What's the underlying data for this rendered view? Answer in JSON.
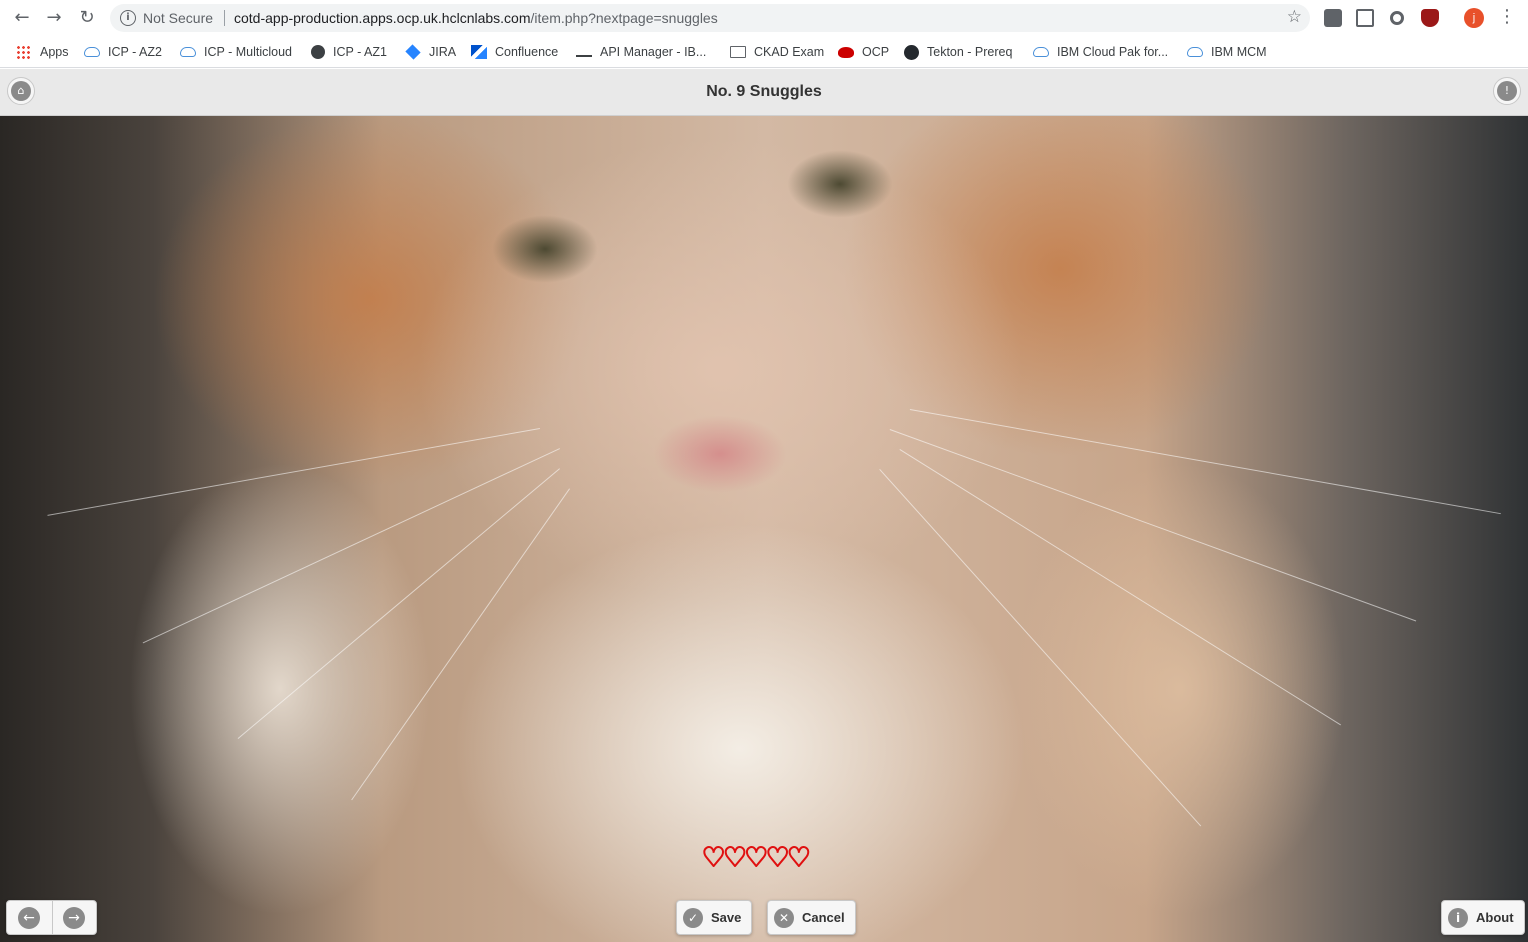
{
  "browser": {
    "address": {
      "security_label": "Not Secure",
      "url_host": "cotd-app-production.apps.ocp.uk.hclcnlabs.com",
      "url_path": "/item.php?nextpage=snuggles"
    },
    "profile_initial": "j",
    "bookmarks": [
      {
        "label": "Apps",
        "icon": "apps-grid-icon"
      },
      {
        "label": "ICP - AZ2",
        "icon": "cloud-icon"
      },
      {
        "label": "ICP - Multicloud",
        "icon": "cloud-icon"
      },
      {
        "label": "ICP - AZ1",
        "icon": "globe-icon"
      },
      {
        "label": "JIRA",
        "icon": "jira-icon"
      },
      {
        "label": "Confluence",
        "icon": "confluence-icon"
      },
      {
        "label": "API Manager - IB...",
        "icon": "key-icon"
      },
      {
        "label": "CKAD Exam",
        "icon": "folder-icon"
      },
      {
        "label": "OCP",
        "icon": "redhat-icon"
      },
      {
        "label": "Tekton - Prereq",
        "icon": "github-icon"
      },
      {
        "label": "IBM Cloud Pak for...",
        "icon": "cloud-icon"
      },
      {
        "label": "IBM MCM",
        "icon": "cloud-icon"
      }
    ]
  },
  "page": {
    "title": "No. 9 Snuggles",
    "rating": {
      "value": 0,
      "max": 5,
      "color": "#e01010"
    },
    "buttons": {
      "save": "Save",
      "cancel": "Cancel",
      "about": "About"
    }
  }
}
